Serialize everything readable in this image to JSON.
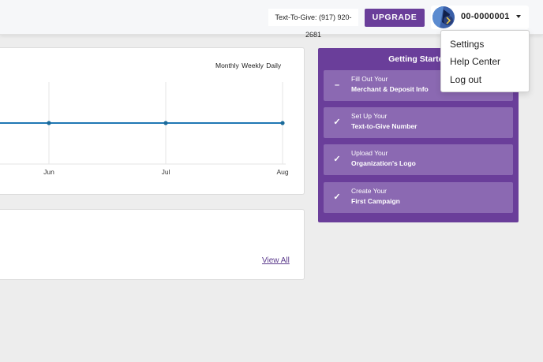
{
  "header": {
    "text_to_give": "Text-To-Give: (917) 920-2681",
    "upgrade_label": "UPGRADE",
    "account_id": "00-0000001"
  },
  "account_menu": {
    "items": [
      {
        "label": "Settings"
      },
      {
        "label": "Help Center"
      },
      {
        "label": "Log out"
      }
    ]
  },
  "chart_card": {
    "range_options": "Monthly Weekly Daily"
  },
  "chart_data": {
    "type": "line",
    "x": [
      "Jun",
      "Jul",
      "Aug"
    ],
    "series": [
      {
        "values": [
          0,
          0,
          0
        ]
      }
    ],
    "xlabel": "",
    "ylabel": "",
    "grid": true,
    "color": "#1f77b4"
  },
  "list_card": {
    "view_all_label": "View All"
  },
  "getting_started": {
    "title": "Getting Started",
    "steps": [
      {
        "line1": "Fill Out Your",
        "line2": "Merchant & Deposit Info",
        "icon": "minus-icon",
        "glyph": "–"
      },
      {
        "line1": "Set Up Your",
        "line2": "Text-to-Give Number",
        "icon": "check-icon",
        "glyph": "✓"
      },
      {
        "line1": "Upload Your",
        "line2": "Organization's Logo",
        "icon": "check-icon",
        "glyph": "✓"
      },
      {
        "line1": "Create Your",
        "line2": "First Campaign",
        "icon": "check-icon",
        "glyph": "✓"
      }
    ]
  },
  "colors": {
    "brand_purple": "#6a3e9a",
    "step_purple": "#8b69b2",
    "line_blue": "#1f77b4"
  }
}
